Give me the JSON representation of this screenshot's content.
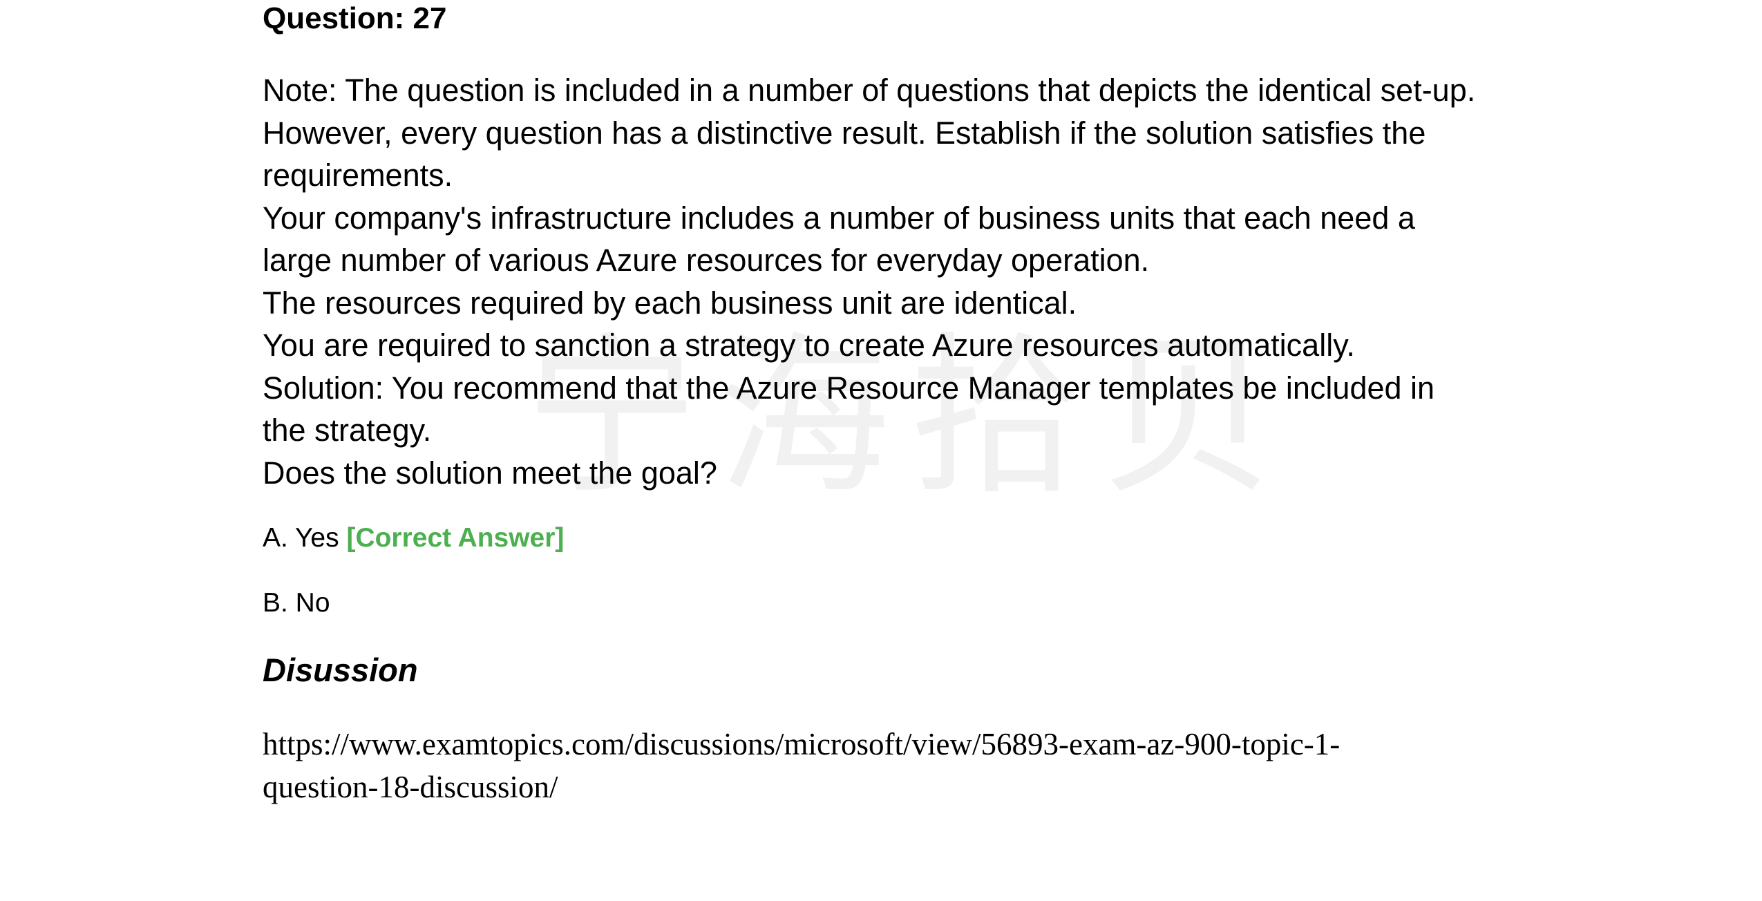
{
  "question": {
    "title": "Question: 27",
    "body_lines": [
      "Note: The question is included in a number of questions that depicts the identical set-up.",
      "However, every question has a distinctive result. Establish if the solution satisfies the",
      "requirements.",
      "Your company's infrastructure includes a number of business units that each need a",
      "large number of various Azure resources for everyday operation.",
      "The resources required by each business unit are identical.",
      "You are required to sanction a strategy to create Azure resources automatically.",
      "Solution: You recommend that the Azure Resource Manager templates be included in",
      "the strategy.",
      "Does the solution meet the goal?"
    ]
  },
  "options": [
    {
      "label": "A. Yes",
      "tag": "[Correct Answer]"
    },
    {
      "label": "B. No",
      "tag": ""
    }
  ],
  "colors": {
    "correct_answer": "#4caf50",
    "watermark": "#f1f1f1"
  },
  "watermark_text": "宁海拾贝",
  "discussion": {
    "heading": "Disussion",
    "link_lines": [
      "https://www.examtopics.com/discussions/microsoft/view/56893-exam-az-900-topic-1-",
      "question-18-discussion/"
    ]
  }
}
